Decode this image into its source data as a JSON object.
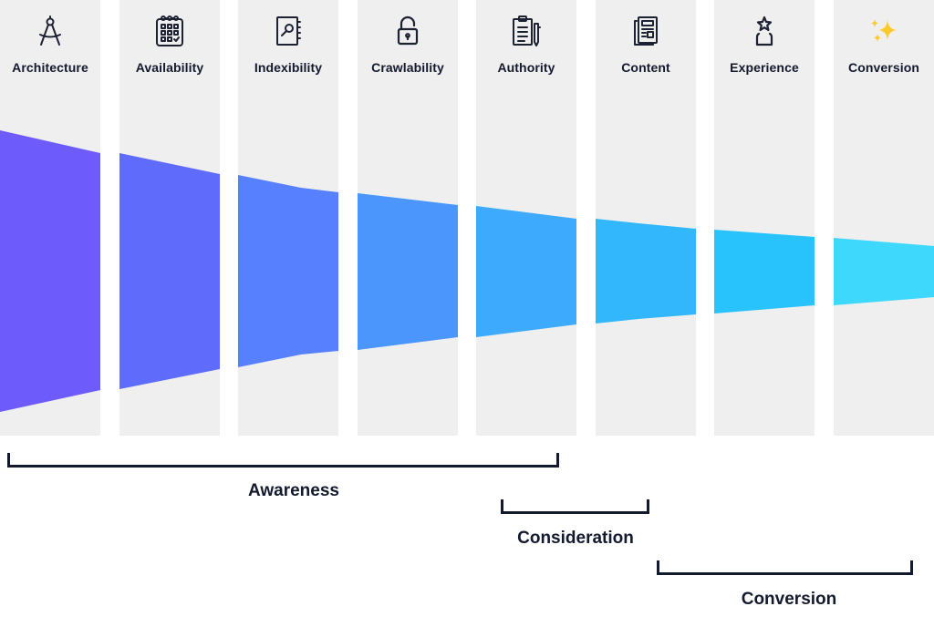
{
  "columns": [
    {
      "label": "Architecture",
      "icon": "compass-icon"
    },
    {
      "label": "Availability",
      "icon": "calendar-icon"
    },
    {
      "label": "Indexibility",
      "icon": "index-book-icon"
    },
    {
      "label": "Crawlability",
      "icon": "unlocked-padlock-icon"
    },
    {
      "label": "Authority",
      "icon": "clipboard-pen-icon"
    },
    {
      "label": "Content",
      "icon": "newspaper-icon"
    },
    {
      "label": "Experience",
      "icon": "star-badge-icon"
    },
    {
      "label": "Conversion",
      "icon": "sparkles-icon"
    }
  ],
  "funnel": {
    "colors": [
      "#6e5bfb",
      "#5f6cfb",
      "#5680fd",
      "#4a96fd",
      "#3eaafd",
      "#32b7fd",
      "#28c2fd",
      "#3fd8fd"
    ]
  },
  "stages": [
    {
      "label": "Awareness"
    },
    {
      "label": "Consideration"
    },
    {
      "label": "Conversion"
    }
  ]
}
